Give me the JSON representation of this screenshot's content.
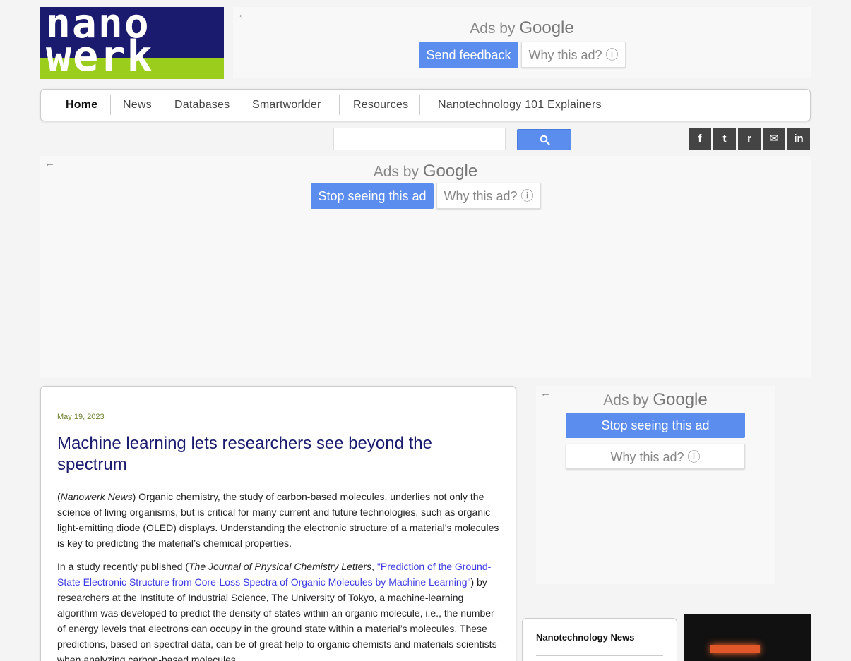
{
  "logo": {
    "line1": "nano",
    "line2": "werk"
  },
  "ads": {
    "top": {
      "ads_by": "Ads by",
      "brand": "Google",
      "primary": "Send feedback",
      "secondary": "Why this ad? ⓘ"
    },
    "wide": {
      "ads_by": "Ads by",
      "brand": "Google",
      "primary": "Stop seeing this ad",
      "secondary": "Why this ad? ⓘ"
    },
    "side": {
      "ads_by": "Ads by",
      "brand": "Google",
      "primary": "Stop seeing this ad",
      "secondary": "Why this ad? ⓘ"
    }
  },
  "nav": {
    "items": [
      "Home",
      "News",
      "Databases",
      "Smartworlder",
      "Resources",
      "Nanotechnology 101 Explainers"
    ]
  },
  "search": {
    "placeholder": ""
  },
  "social": [
    "f",
    "t",
    "r",
    "✉",
    "in"
  ],
  "article": {
    "date": "May 19, 2023",
    "title": "Machine learning lets researchers see beyond the spectrum",
    "p1_source": "Nanowerk News",
    "p1_text": ") Organic chemistry, the study of carbon-based molecules, underlies not only the science of living organisms, but is critical for many current and future technologies, such as organic light-emitting diode (OLED) displays. Understanding the electronic structure of a material’s molecules is key to predicting the material’s chemical properties.",
    "p2_lead": "In a study recently published (",
    "p2_journal": "The Journal of Physical Chemistry Letters",
    "p2_link": "\"Prediction of the Ground-State Electronic Structure from Core-Loss Spectra of Organic Molecules by Machine Learning\"",
    "p2_text": ") by researchers at the Institute of Industrial Science, The University of Tokyo, a machine-learning algorithm was developed to predict the density of states within an organic molecule, i.e., the number of energy levels that electrons can occupy in the ground state within a material’s molecules. These predictions, based on spectral data, can be of great help to organic chemists and materials scientists when analyzing carbon-based molecules."
  },
  "sidebar": {
    "news_title": "Nanotechnology News"
  },
  "colors": {
    "navy": "#1a1a6e",
    "lime": "#9acd1c",
    "google_blue": "#5b8def",
    "date_green": "#6a7f2c"
  }
}
